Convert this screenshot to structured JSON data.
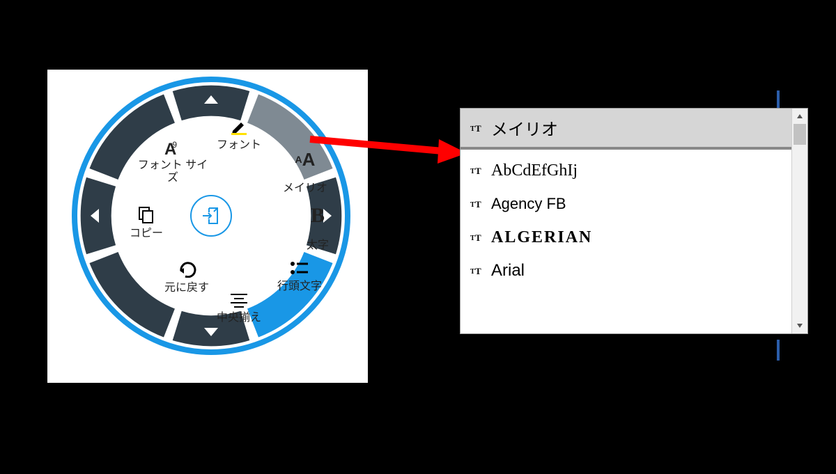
{
  "colors": {
    "ring_base": "#2f3d48",
    "ring_accent": "#1997e6",
    "ring_hover": "#7f8a93",
    "arrow": "#ff0000"
  },
  "radial": {
    "tools": {
      "font": {
        "label": "フォント"
      },
      "font_size": {
        "label": "フォント サイズ",
        "badge": "9"
      },
      "font_family": {
        "label": "メイリオ"
      },
      "copy": {
        "label": "コピー"
      },
      "bold": {
        "label": "太字"
      },
      "undo": {
        "label": "元に戻す"
      },
      "bullets": {
        "label": "行頭文字"
      },
      "align_center": {
        "label": "中央揃え"
      }
    }
  },
  "font_dropdown": {
    "selected": "メイリオ",
    "items": [
      {
        "name": "メイリオ",
        "css": "",
        "selected": true
      },
      {
        "name": "AbCdEfGhIj",
        "css": "font-sample",
        "selected": false
      },
      {
        "name": "Agency FB",
        "css": "font-agency",
        "selected": false
      },
      {
        "name": "ALGERIAN",
        "css": "font-alger",
        "selected": false
      },
      {
        "name": "Arial",
        "css": "font-arial",
        "selected": false
      }
    ]
  }
}
